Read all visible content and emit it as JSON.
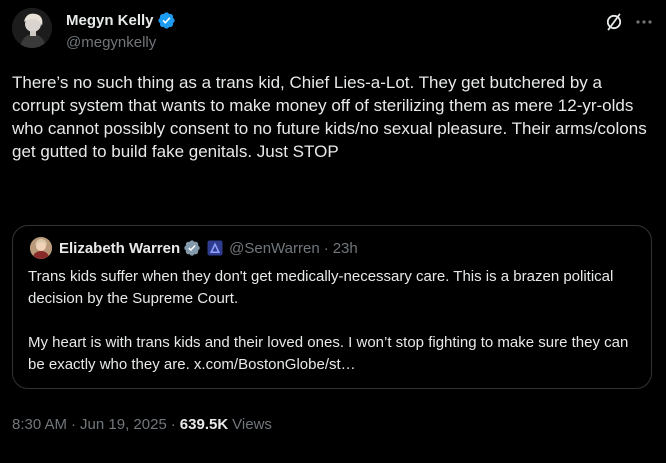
{
  "author": {
    "display_name": "Megyn Kelly",
    "handle": "@megynkelly",
    "avatar_icon": "profile-photo"
  },
  "post": {
    "text": "There’s no such thing as a trans kid, Chief Lies-a-Lot. They get butchered by a corrupt system that wants to make money off of sterilizing them as mere 12-yr-olds who cannot possibly consent to no future kids/no sexual pleasure. Their arms/colons get gutted to build fake genitals. Just STOP",
    "time": "8:30 AM",
    "date": "Jun 19, 2025",
    "separator": "·",
    "views_count": "639.5K",
    "views_label": "Views"
  },
  "quoted_post": {
    "display_name": "Elizabeth Warren",
    "handle": "@SenWarren",
    "separator": "·",
    "time_ago": "23h",
    "paragraphs": [
      "Trans kids suffer when they don't get medically-necessary care. This is a brazen political decision by the Supreme Court.",
      "My heart is with trans kids and their loved ones. I won’t stop fighting to make sure they can be exactly who they are. x.com/BostonGlobe/st…"
    ]
  },
  "icons": {
    "verified": "verified-badge-icon",
    "government_badge": "government-affiliation-icon",
    "grok": "grok-icon",
    "more": "more-options-icon"
  },
  "colors": {
    "background": "#000000",
    "text_primary": "#e7e9ea",
    "text_secondary": "#71767b",
    "verified_blue": "#1d9bf0",
    "border": "#2f3336",
    "gov_badge": "#5b6cf0"
  }
}
